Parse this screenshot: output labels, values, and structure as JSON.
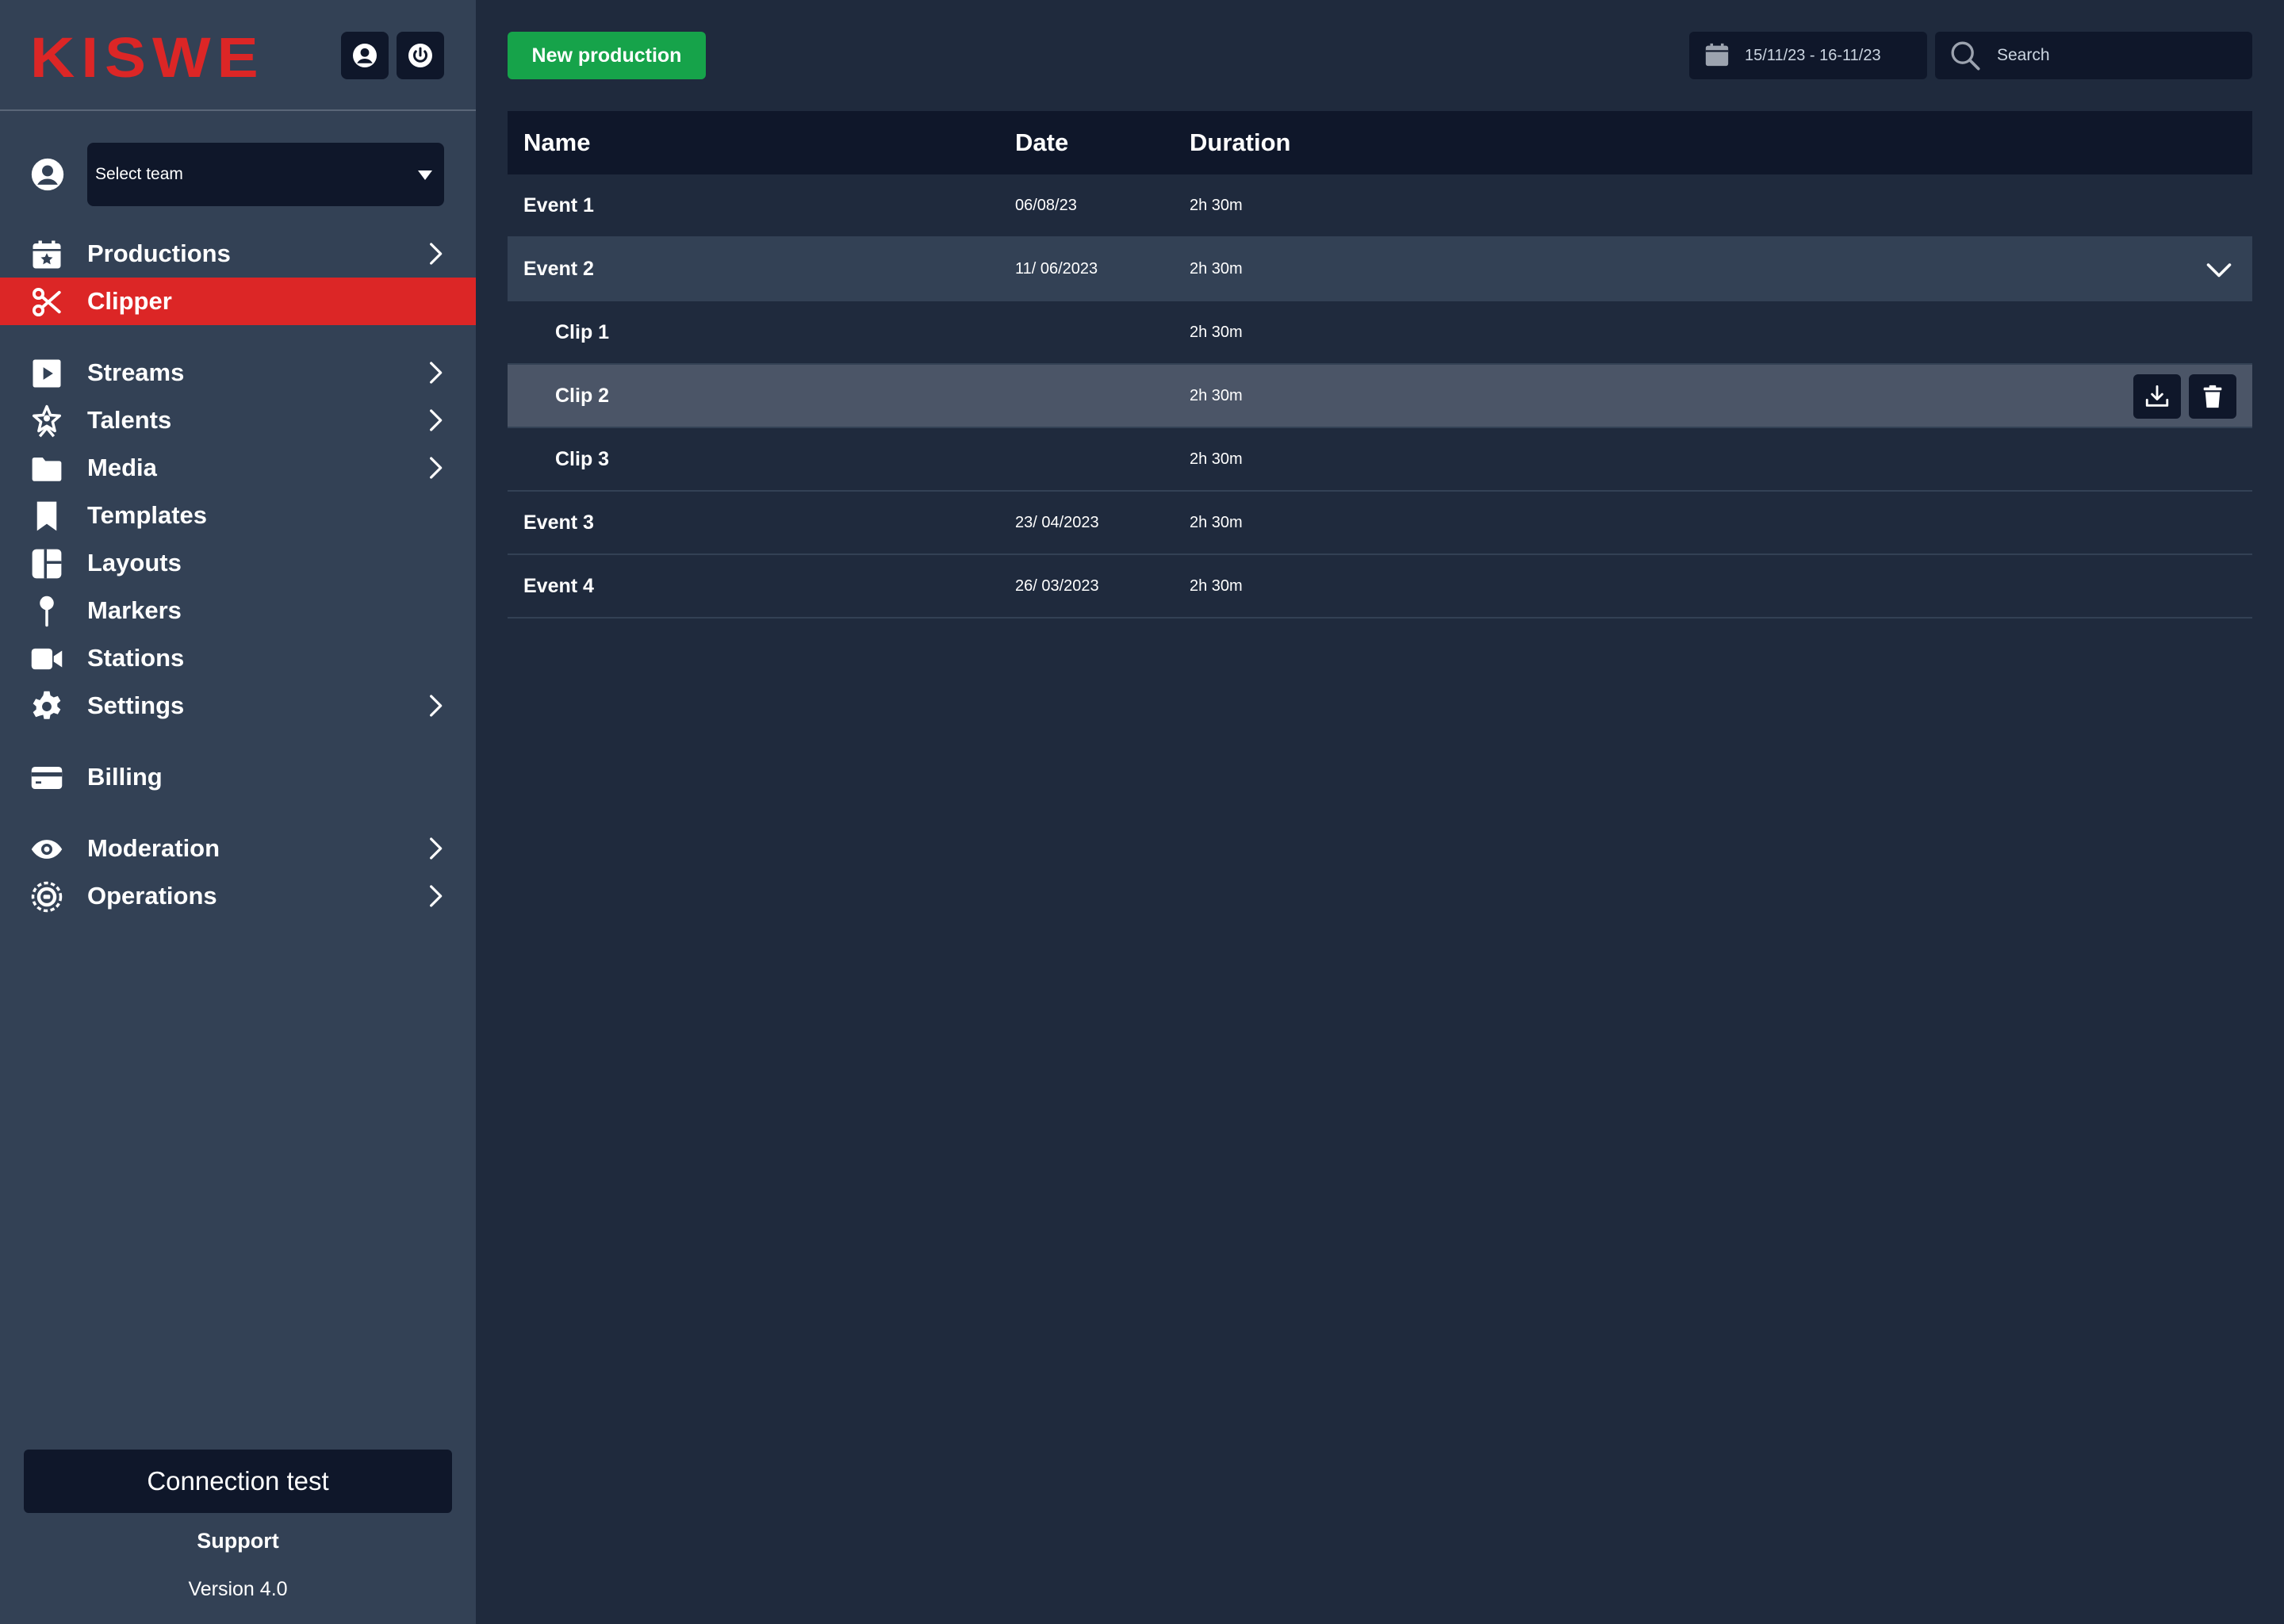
{
  "brand": {
    "logo_text": "KISWE",
    "accent": "#dc2626"
  },
  "sidebar": {
    "team_select": {
      "value": "Select team"
    },
    "items": [
      {
        "label": "Productions",
        "icon": "calendar-star-icon",
        "has_submenu": true,
        "active": false
      },
      {
        "label": "Clipper",
        "icon": "scissors-icon",
        "has_submenu": false,
        "active": true
      },
      {
        "label": "Streams",
        "icon": "play-icon",
        "has_submenu": true,
        "active": false
      },
      {
        "label": "Talents",
        "icon": "star-person-icon",
        "has_submenu": true,
        "active": false
      },
      {
        "label": "Media",
        "icon": "folder-icon",
        "has_submenu": true,
        "active": false
      },
      {
        "label": "Templates",
        "icon": "bookmark-icon",
        "has_submenu": false,
        "active": false
      },
      {
        "label": "Layouts",
        "icon": "layout-icon",
        "has_submenu": false,
        "active": false
      },
      {
        "label": "Markers",
        "icon": "pin-icon",
        "has_submenu": false,
        "active": false
      },
      {
        "label": "Stations",
        "icon": "video-camera-icon",
        "has_submenu": false,
        "active": false
      },
      {
        "label": "Settings",
        "icon": "gear-icon",
        "has_submenu": true,
        "active": false
      },
      {
        "label": "Billing",
        "icon": "credit-card-icon",
        "has_submenu": false,
        "active": false
      },
      {
        "label": "Moderation",
        "icon": "eye-icon",
        "has_submenu": true,
        "active": false
      },
      {
        "label": "Operations",
        "icon": "ops-gear-icon",
        "has_submenu": true,
        "active": false
      }
    ],
    "connection_test_label": "Connection test",
    "support_label": "Support",
    "version_label": "Version 4.0"
  },
  "toolbar": {
    "new_production_label": "New production",
    "date_range": "15/11/23 -  16-11/23",
    "search_placeholder": "Search"
  },
  "table": {
    "columns": [
      "Name",
      "Date",
      "Duration"
    ],
    "rows": [
      {
        "name": "Event 1",
        "date": "06/08/23",
        "duration": "2h 30m"
      },
      {
        "name": "Event 2",
        "date": "11/ 06/2023",
        "duration": "2h 30m"
      },
      {
        "name": "Clip 1",
        "date": "",
        "duration": "2h 30m"
      },
      {
        "name": "Clip 2",
        "date": "",
        "duration": "2h 30m"
      },
      {
        "name": "Clip 3",
        "date": "",
        "duration": "2h 30m"
      },
      {
        "name": "Event 3",
        "date": "23/ 04/2023",
        "duration": "2h 30m"
      },
      {
        "name": "Event 4",
        "date": "26/ 03/2023",
        "duration": "2h 30m"
      }
    ]
  },
  "colors": {
    "sidebar_bg": "#334155",
    "main_bg": "#1f2a3d",
    "dark": "#0f172a",
    "active": "#dc2626",
    "primary_button": "#16a34a",
    "selected_row": "#4b5567"
  }
}
